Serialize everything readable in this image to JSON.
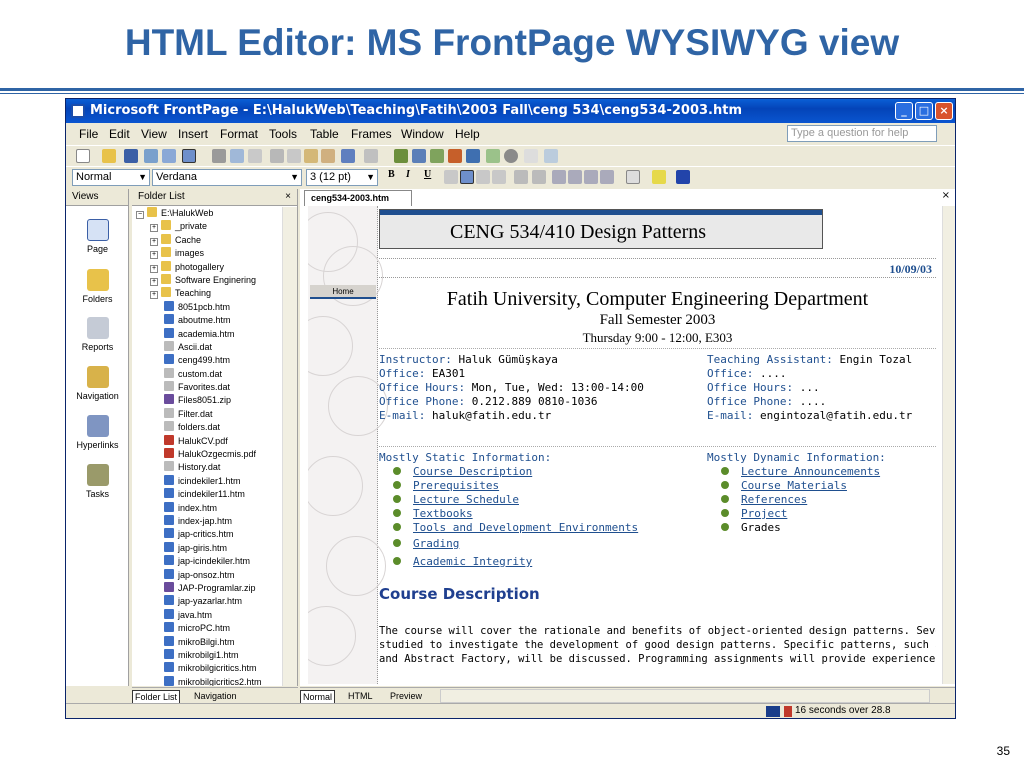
{
  "slide": {
    "title": "HTML Editor: MS FrontPage WYSIWYG view",
    "page_number": "35"
  },
  "window": {
    "title": "Microsoft FrontPage - E:\\HalukWeb\\Teaching\\Fatih\\2003 Fall\\ceng 534\\ceng534-2003.htm",
    "minimize": "_",
    "maximize": "□",
    "close": "×"
  },
  "menu": {
    "items": [
      "File",
      "Edit",
      "View",
      "Insert",
      "Format",
      "Tools",
      "Table",
      "Frames",
      "Window",
      "Help"
    ],
    "help_placeholder": "Type a question for help"
  },
  "format": {
    "style": "Normal",
    "font": "Verdana",
    "size": "3 (12 pt)",
    "bold": "B",
    "italic": "I",
    "underline": "U"
  },
  "views": {
    "header": "Views",
    "items": [
      "Page",
      "Folders",
      "Reports",
      "Navigation",
      "Hyperlinks",
      "Tasks"
    ]
  },
  "folders": {
    "header": "Folder List",
    "close": "×",
    "root": "E:\\HalukWeb",
    "dirs": [
      "_private",
      "Cache",
      "images",
      "photogallery",
      "Software Enginering",
      "Teaching"
    ],
    "files": [
      "8051pcb.htm",
      "aboutme.htm",
      "academia.htm",
      "Ascii.dat",
      "ceng499.htm",
      "custom.dat",
      "Favorites.dat",
      "Files8051.zip",
      "Filter.dat",
      "folders.dat",
      "HalukCV.pdf",
      "HalukOzgecmis.pdf",
      "History.dat",
      "icindekiler1.htm",
      "icindekiler11.htm",
      "index.htm",
      "index-jap.htm",
      "jap-critics.htm",
      "jap-giris.htm",
      "jap-icindekiler.htm",
      "jap-onsoz.htm",
      "JAP-Programlar.zip",
      "jap-yazarlar.htm",
      "java.htm",
      "microPC.htm",
      "mikroBilgi.htm",
      "mikrobilgi1.htm",
      "mikrobilgicritics.htm",
      "mikrobilgicritics2.htm"
    ],
    "bottom_tabs": [
      "Folder List",
      "Navigation"
    ]
  },
  "editor": {
    "tab": "ceng534-2003.htm",
    "close": "×",
    "banner": "CENG 534/410 Design Patterns",
    "date": "10/09/03",
    "home": "Home",
    "heading": "Fatih University, Computer Engineering Department",
    "semester": "Fall Semester 2003",
    "schedule": "Thursday 9:00 - 12:00, E303",
    "left_info": [
      {
        "label": "Instructor:",
        "value": "Haluk Gümüşkaya"
      },
      {
        "label": "Office:",
        "value": "EA301"
      },
      {
        "label": "Office Hours:",
        "value": "Mon, Tue, Wed: 13:00-14:00"
      },
      {
        "label": "Office Phone:",
        "value": "0.212.889 0810-1036"
      },
      {
        "label": "E-mail:",
        "value": "haluk@fatih.edu.tr"
      }
    ],
    "right_info": [
      {
        "label": "Teaching Assistant:",
        "value": "Engin Tozal"
      },
      {
        "label": "Office:",
        "value": "...."
      },
      {
        "label": "Office Hours:",
        "value": "..."
      },
      {
        "label": "Office Phone:",
        "value": "...."
      },
      {
        "label": "E-mail:",
        "value": "engintozal@fatih.edu.tr"
      }
    ],
    "static_header": "Mostly Static Information:",
    "static_links": [
      "Course Description",
      "Prerequisites",
      "Lecture Schedule",
      "Textbooks",
      "Tools and Development Environments",
      "Grading",
      "Academic Integrity"
    ],
    "dynamic_header": "Mostly Dynamic Information:",
    "dynamic_links": [
      "Lecture Announcements",
      "Course Materials",
      "References",
      "Project",
      "Grades"
    ],
    "course_desc_heading": "Course Description",
    "course_desc_lines": [
      "The course will cover the rationale and benefits of object-oriented design patterns. Several exampl",
      "studied to investigate the development of good design patterns. Specific patterns, such as Observ",
      "and Abstract Factory, will be discussed. Programming assignments will provide experience in the use"
    ],
    "bottom_tabs": [
      "Normal",
      "HTML",
      "Preview"
    ]
  },
  "status": {
    "timing": "16 seconds over 28.8"
  }
}
